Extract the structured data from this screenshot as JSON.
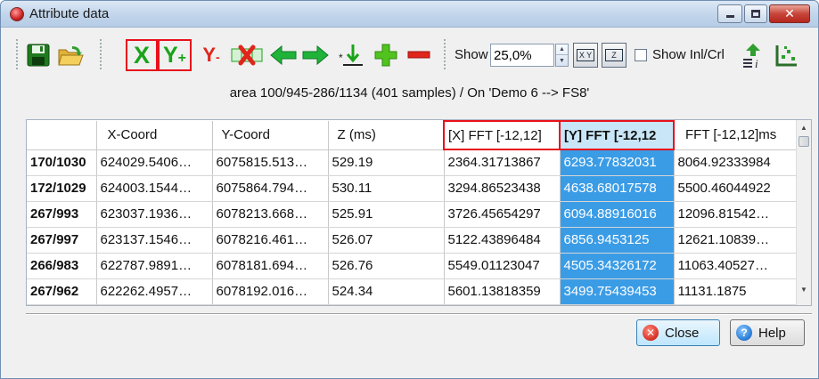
{
  "window": {
    "title": "Attribute data",
    "minimize_icon": "minimize-icon",
    "maximize_icon": "maximize-icon",
    "close_icon": "close-x-icon",
    "close_glyph": "✕"
  },
  "toolbar": {
    "x_label": "X",
    "y_plus_label": "Y",
    "y_plus_suffix": "+",
    "y_minus_label": "Y",
    "y_minus_suffix": "-",
    "show_label": "Show",
    "show_value": "25,0%",
    "toggle_xy_text": "X Y",
    "toggle_z_text": "Z",
    "show_inl_label": "Show Inl/Crl",
    "icons": [
      "save-icon",
      "open-folder-icon",
      "set-x-icon",
      "add-y-icon",
      "remove-y-icon",
      "delete-column-icon",
      "arrow-left-icon",
      "arrow-right-icon",
      "insert-down-icon",
      "add-icon",
      "remove-icon",
      "xy-toggle-icon",
      "z-toggle-icon",
      "inline-crossline-icon",
      "export-icon"
    ]
  },
  "info_line": "area 100/945-286/1134 (401 samples) / On 'Demo 6 --> FS8'",
  "table": {
    "columns": [
      "",
      "X-Coord",
      "Y-Coord",
      "Z (ms)",
      "[X] FFT [-12,12]",
      "[Y] FFT [-12,12",
      "FFT [-12,12]ms"
    ],
    "rows": [
      [
        "170/1030",
        "624029.5406…",
        "6075815.513…",
        "529.19",
        "2364.31713867",
        "6293.77832031",
        "8064.92333984"
      ],
      [
        "172/1029",
        "624003.1544…",
        "6075864.794…",
        "530.11",
        "3294.86523438",
        "4638.68017578",
        "5500.46044922"
      ],
      [
        "267/993",
        "623037.1936…",
        "6078213.668…",
        "525.91",
        "3726.45654297",
        "6094.88916016",
        "12096.81542…"
      ],
      [
        "267/997",
        "623137.1546…",
        "6078216.461…",
        "526.07",
        "5122.43896484",
        "6856.9453125",
        "12621.10839…"
      ],
      [
        "266/983",
        "622787.9891…",
        "6078181.694…",
        "526.76",
        "5549.01123047",
        "4505.34326172",
        "11063.40527…"
      ],
      [
        "267/962",
        "622262.4957…",
        "6078192.016…",
        "524.34",
        "5601.13818359",
        "3499.75439453",
        "11131.1875"
      ]
    ],
    "scroll_up": "▲",
    "scroll_down": "▼"
  },
  "buttons": {
    "close_label": "Close",
    "close_icon_glyph": "✕",
    "help_label": "Help",
    "help_icon_glyph": "?"
  },
  "colors": {
    "selection": "#3b9ce6",
    "highlight_frame": "#e8111c",
    "green_icon": "#1aa31a",
    "title_gradient": "#bfd3ea"
  }
}
